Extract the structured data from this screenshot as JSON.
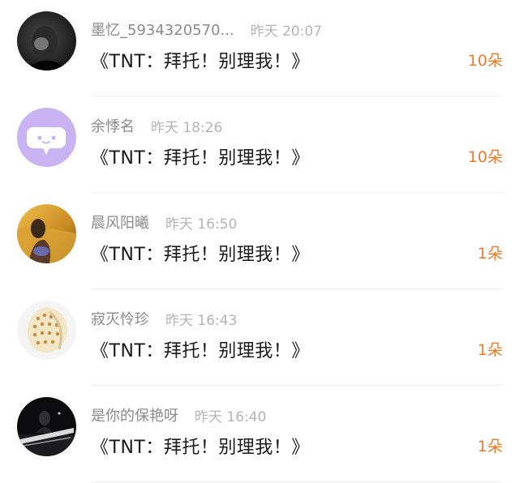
{
  "gift_list": {
    "items": [
      {
        "username": "墨忆_5934320570...",
        "time": "昨天 20:07",
        "gift": "《TNT：拜托！别理我！》",
        "count": "10朵",
        "avatar": "dark-photo-avatar"
      },
      {
        "username": "余悸名",
        "time": "昨天 18:26",
        "gift": "《TNT：拜托！别理我！》",
        "count": "10朵",
        "avatar": "default-chat-bubble-avatar"
      },
      {
        "username": "晨风阳曦",
        "time": "昨天 16:50",
        "gift": "《TNT：拜托！别理我！》",
        "count": "1朵",
        "avatar": "wheat-field-photo-avatar"
      },
      {
        "username": "寂灭怜珍",
        "time": "昨天 16:43",
        "gift": "《TNT：拜托！别理我！》",
        "count": "1朵",
        "avatar": "seashell-photo-avatar"
      },
      {
        "username": "是你的保艳呀",
        "time": "昨天 16:40",
        "gift": "《TNT：拜托！别理我！》",
        "count": "1朵",
        "avatar": "night-scene-photo-avatar"
      }
    ]
  },
  "colors": {
    "username": "#8a8a8a",
    "time": "#b4b4b4",
    "gift_text": "#1a1a1a",
    "count": "#f07a2a",
    "default_avatar_bg": "#c9b3f2"
  }
}
